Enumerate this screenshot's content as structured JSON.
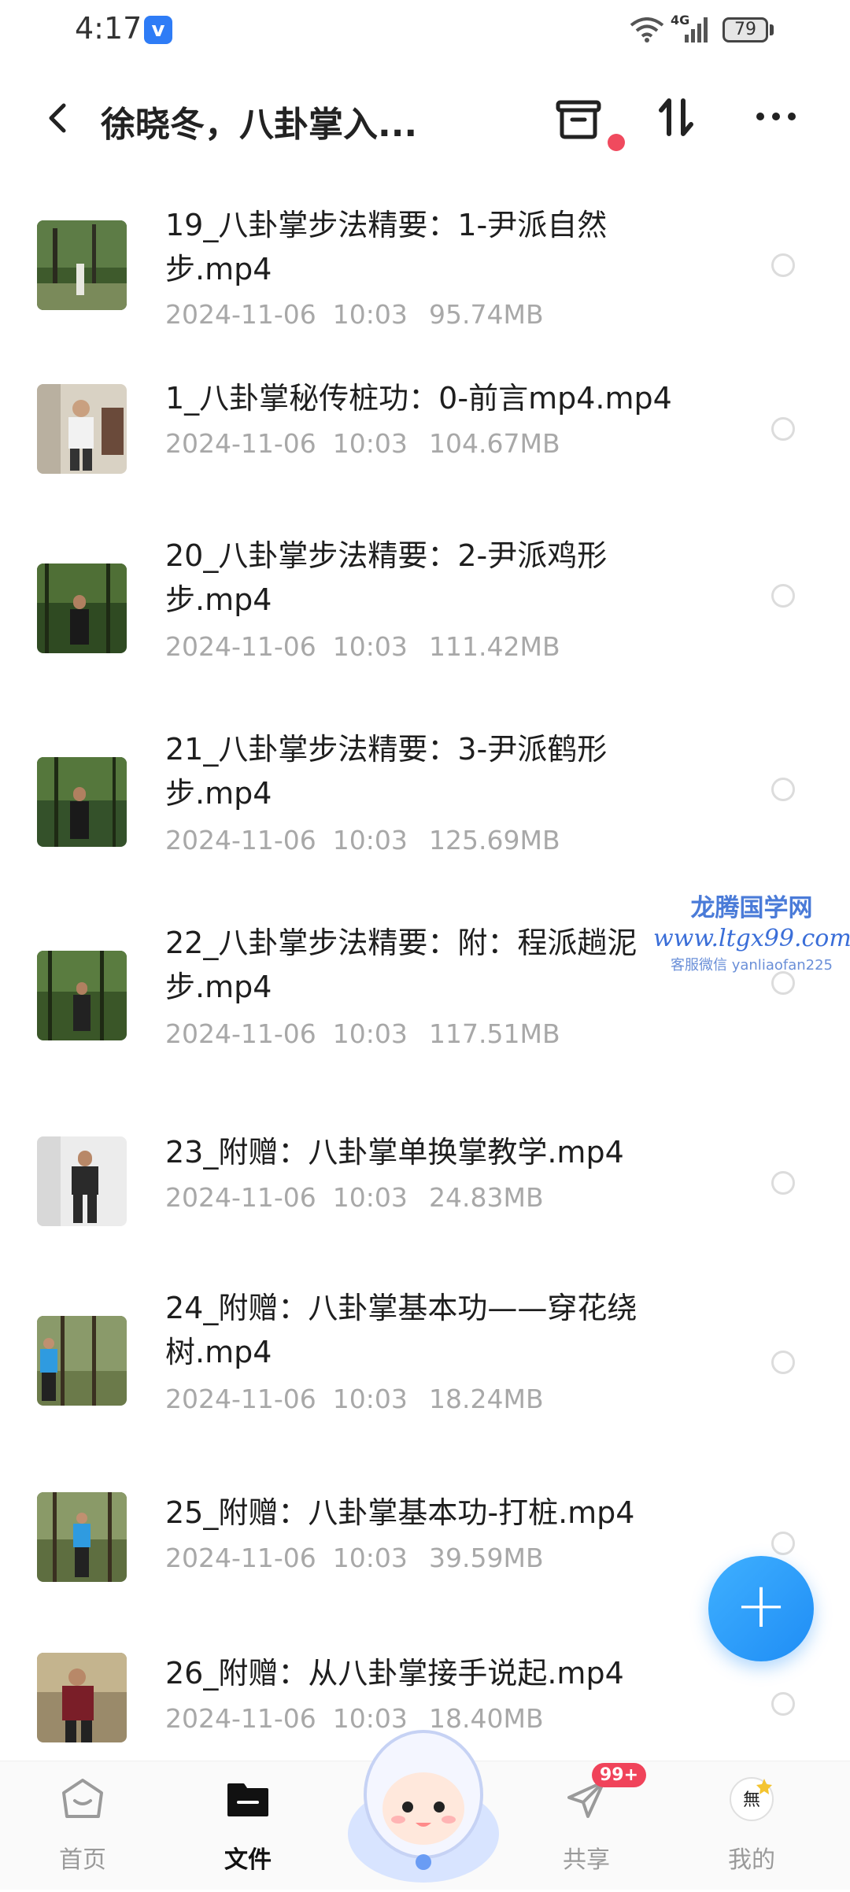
{
  "status_bar": {
    "time": "4:17",
    "app_icon": "v",
    "network": "4G",
    "battery": "79"
  },
  "header": {
    "title": "徐晓冬，八卦掌入...",
    "back_icon": "chevron-left-icon",
    "archive_icon": "archive-icon",
    "sort_icon": "sort-icon",
    "more_icon": "more-icon"
  },
  "files": [
    {
      "name": "19_八卦掌步法精要：1-尹派自然步.mp4",
      "date": "2024-11-06  10:03",
      "size": "95.74MB"
    },
    {
      "name": "1_八卦掌秘传桩功：0-前言mp4.mp4",
      "date": "2024-11-06  10:03",
      "size": "104.67MB"
    },
    {
      "name": "20_八卦掌步法精要：2-尹派鸡形步.mp4",
      "date": "2024-11-06  10:03",
      "size": "111.42MB"
    },
    {
      "name": "21_八卦掌步法精要：3-尹派鹤形步.mp4",
      "date": "2024-11-06  10:03",
      "size": "125.69MB"
    },
    {
      "name": "22_八卦掌步法精要：附：程派趟泥步.mp4",
      "date": "2024-11-06  10:03",
      "size": "117.51MB"
    },
    {
      "name": "23_附赠：八卦掌单换掌教学.mp4",
      "date": "2024-11-06  10:03",
      "size": "24.83MB"
    },
    {
      "name": "24_附赠：八卦掌基本功——穿花绕树.mp4",
      "date": "2024-11-06  10:03",
      "size": "18.24MB"
    },
    {
      "name": "25_附赠：八卦掌基本功-打桩.mp4",
      "date": "2024-11-06  10:03",
      "size": "39.59MB"
    },
    {
      "name": "26_附赠：从八卦掌接手说起.mp4",
      "date": "2024-11-06  10:03",
      "size": "18.40MB"
    }
  ],
  "watermark": {
    "line1": "龙腾国学网",
    "line2": "www.ltgx99.com",
    "line3": "客服微信 yanliaofan225"
  },
  "fab": {
    "label": "+"
  },
  "bottom_nav": {
    "home": "首页",
    "files": "文件",
    "share": "共享",
    "share_badge": "99+",
    "mine": "我的"
  },
  "colors": {
    "accent": "#1f8df5",
    "badge": "#f0435a",
    "notif_dot": "#f04a5e",
    "meta_text": "#a8a8a8"
  }
}
